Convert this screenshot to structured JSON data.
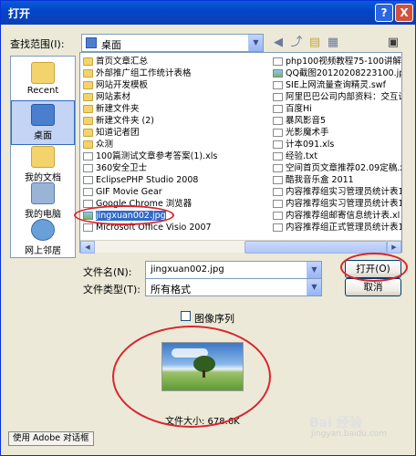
{
  "title": "打开",
  "titlebar": {
    "help_label": "?",
    "close_label": "X"
  },
  "lookin": {
    "label": "查找范围(I):",
    "value": "桌面"
  },
  "places": [
    {
      "label": "Recent",
      "icon": "recent-folder-icon",
      "selected": false
    },
    {
      "label": "桌面",
      "icon": "desktop-icon",
      "selected": true
    },
    {
      "label": "我的文档",
      "icon": "my-documents-icon",
      "selected": false
    },
    {
      "label": "我的电脑",
      "icon": "my-computer-icon",
      "selected": false
    },
    {
      "label": "网上邻居",
      "icon": "network-icon",
      "selected": false
    }
  ],
  "files_left": [
    {
      "name": "首页文章汇总",
      "kind": "folder"
    },
    {
      "name": "外部推广组工作统计表格",
      "kind": "folder"
    },
    {
      "name": "网站开发模板",
      "kind": "folder"
    },
    {
      "name": "网站素材",
      "kind": "folder"
    },
    {
      "name": "新建文件夹",
      "kind": "folder"
    },
    {
      "name": "新建文件夹 (2)",
      "kind": "folder"
    },
    {
      "name": "知道记者团",
      "kind": "folder"
    },
    {
      "name": "众测",
      "kind": "folder"
    },
    {
      "name": "100篇测试文章参考答案(1).xls",
      "kind": "file"
    },
    {
      "name": "360安全卫士",
      "kind": "file"
    },
    {
      "name": "EclipsePHP Studio 2008",
      "kind": "file"
    },
    {
      "name": "GIF Movie Gear",
      "kind": "file"
    },
    {
      "name": "Google Chrome 浏览器",
      "kind": "file"
    },
    {
      "name": "jingxuan002.jpg",
      "kind": "image",
      "selected": true
    },
    {
      "name": "Microsoft Office Visio 2007",
      "kind": "file"
    }
  ],
  "files_right": [
    {
      "name": "php100视频教程75-100讲解压",
      "kind": "file"
    },
    {
      "name": "QQ截图20120208223100.jpg",
      "kind": "image"
    },
    {
      "name": "SIE上网流量查询精灵.swf",
      "kind": "file"
    },
    {
      "name": "阿里巴巴公司内部资料：交互设",
      "kind": "file"
    },
    {
      "name": "百度Hi",
      "kind": "file"
    },
    {
      "name": "暴风影音5",
      "kind": "file"
    },
    {
      "name": "光影魔术手",
      "kind": "file"
    },
    {
      "name": "计本091.xls",
      "kind": "file"
    },
    {
      "name": "经验.txt",
      "kind": "file"
    },
    {
      "name": "空间首页文章推荐02.09定稿.x",
      "kind": "file"
    },
    {
      "name": "酷我音乐盒 2011",
      "kind": "file"
    },
    {
      "name": "内容推荐组实习管理员统计表1",
      "kind": "file"
    },
    {
      "name": "内容推荐组实习管理员统计表1",
      "kind": "file"
    },
    {
      "name": "内容推荐组邮寄信息统计表.xl",
      "kind": "file"
    },
    {
      "name": "内容推荐组正式管理员统计表1",
      "kind": "file"
    }
  ],
  "filename": {
    "label": "文件名(N):",
    "value": "jingxuan002.jpg"
  },
  "filetype": {
    "label": "文件类型(T):",
    "value": "所有格式"
  },
  "buttons": {
    "open": "打开(O)",
    "cancel": "取消"
  },
  "image_sequence": {
    "label": "图像序列",
    "checked": false
  },
  "preview": {
    "size_label": "文件大小: 678.6K"
  },
  "adobe_button": "使用 Adobe 对话框",
  "watermark": {
    "brand": "Bai 经验",
    "url": "jingyan.baidu.com"
  },
  "colors": {
    "accent": "#316ac5",
    "annotation": "#d8262c",
    "titlebar": "#0a5bd8"
  }
}
